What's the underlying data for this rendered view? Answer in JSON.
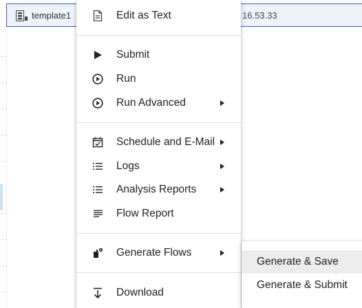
{
  "background": {
    "row_name": "template1",
    "row_time": "16.53.33",
    "row_icon": "flow-template-icon"
  },
  "menu": {
    "items": [
      {
        "label": "Edit as Text",
        "icon": "document-icon"
      },
      {
        "label": "Submit",
        "icon": "play-icon"
      },
      {
        "label": "Run",
        "icon": "play-circle-icon"
      },
      {
        "label": "Run Advanced",
        "icon": "play-circle-icon",
        "submenu": true
      },
      {
        "label": "Schedule and E-Mail",
        "icon": "calendar-check-icon",
        "submenu": true
      },
      {
        "label": "Logs",
        "icon": "list-icon",
        "submenu": true
      },
      {
        "label": "Analysis Reports",
        "icon": "list-icon",
        "submenu": true
      },
      {
        "label": "Flow Report",
        "icon": "lines-icon"
      },
      {
        "label": "Generate Flows",
        "icon": "generate-icon",
        "submenu": true
      },
      {
        "label": "Download",
        "icon": "download-icon"
      }
    ]
  },
  "submenu": {
    "items": [
      {
        "label": "Generate & Save",
        "hovered": true
      },
      {
        "label": "Generate & Submit"
      }
    ]
  }
}
